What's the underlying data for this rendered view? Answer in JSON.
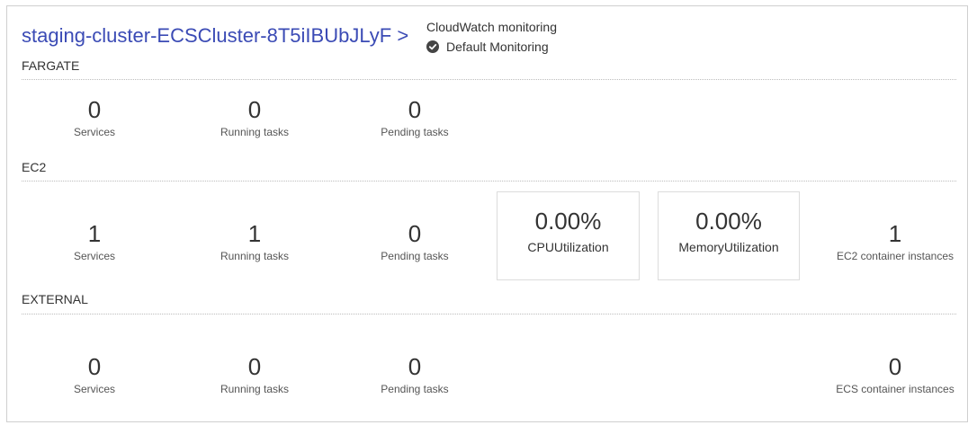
{
  "header": {
    "cluster_name": "staging-cluster-ECSCluster-8T5iIBUbJLyF",
    "chevron": ">",
    "monitoring_title": "CloudWatch monitoring",
    "monitoring_status": "Default Monitoring",
    "monitoring_icon": "check-circle-icon"
  },
  "fargate": {
    "title": "FARGATE",
    "services": {
      "value": "0",
      "label": "Services"
    },
    "running_tasks": {
      "value": "0",
      "label": "Running tasks"
    },
    "pending_tasks": {
      "value": "0",
      "label": "Pending tasks"
    }
  },
  "ec2": {
    "title": "EC2",
    "services": {
      "value": "1",
      "label": "Services"
    },
    "running_tasks": {
      "value": "1",
      "label": "Running tasks"
    },
    "pending_tasks": {
      "value": "0",
      "label": "Pending tasks"
    },
    "cpu": {
      "value": "0.00%",
      "label": "CPUUtilization"
    },
    "memory": {
      "value": "0.00%",
      "label": "MemoryUtilization"
    },
    "instances": {
      "value": "1",
      "label": "EC2 container instances"
    }
  },
  "external": {
    "title": "EXTERNAL",
    "services": {
      "value": "0",
      "label": "Services"
    },
    "running_tasks": {
      "value": "0",
      "label": "Running tasks"
    },
    "pending_tasks": {
      "value": "0",
      "label": "Pending tasks"
    },
    "instances": {
      "value": "0",
      "label": "ECS container instances"
    }
  },
  "colors": {
    "link": "#3b4bb5",
    "border": "#cfcfcf"
  }
}
